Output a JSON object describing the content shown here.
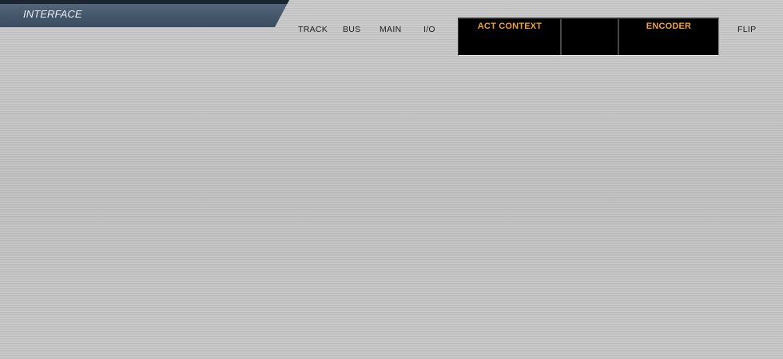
{
  "section": {
    "title": "INTERFACE"
  },
  "mode_buttons": [
    {
      "label": "TRACK"
    },
    {
      "label": "BUS"
    },
    {
      "label": "MAIN"
    },
    {
      "label": "I/O"
    }
  ],
  "display": {
    "cells": [
      {
        "label": "ACT CONTEXT"
      },
      {
        "label": ""
      },
      {
        "label": "ENCODER"
      }
    ]
  },
  "flip": {
    "label": "FLIP"
  },
  "colors": {
    "panel_background": "#c3c3c3",
    "tab_background": "#44566a",
    "tab_text": "#e6ecf2",
    "display_background": "#000000",
    "display_label": "#f0a23a",
    "button_text": "#1e1e1e"
  }
}
